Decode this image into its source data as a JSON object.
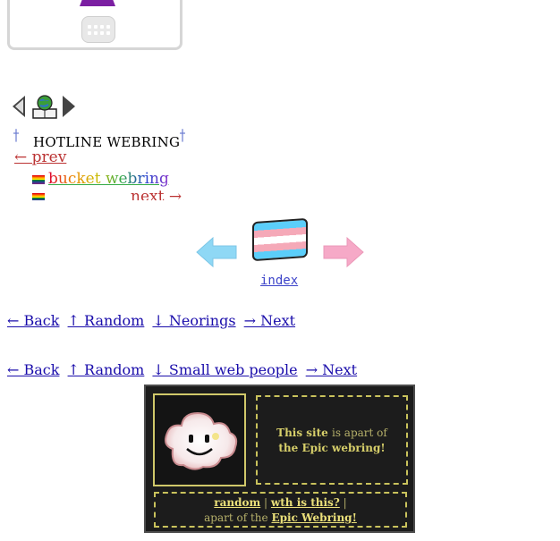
{
  "card": {
    "icon": "apps-grid-icon"
  },
  "webring_nav": {
    "left": "arrow-left-icon",
    "center": "globe-book-icon",
    "right": "arrow-right-icon"
  },
  "hotline": {
    "title": "HOTLINE WEBRING"
  },
  "bucket": {
    "prev": "← prev",
    "name": "bucket webring",
    "next": "next →"
  },
  "trans_ring": {
    "index": "index"
  },
  "nav1": {
    "back": "← Back",
    "random": "↑ Random",
    "down": "↓ Neorings",
    "next": "→ Next"
  },
  "nav2": {
    "back": "← Back",
    "random": "↑ Random",
    "down": "↓ Small web people",
    "next": "→ Next"
  },
  "epic": {
    "this_site": "This site",
    "is_apart": "is apart of",
    "ring_name": "the Epic webring!",
    "random": "random",
    "sep": "|",
    "wth": "wth is this?",
    "sep2": "|",
    "apart_of": "apart of the",
    "epic_link": "Epic Webring!"
  },
  "colors": {
    "trans_blue": "#5bcefa",
    "trans_pink": "#f5a9b8",
    "epic_yellow": "#d7cf6a"
  }
}
